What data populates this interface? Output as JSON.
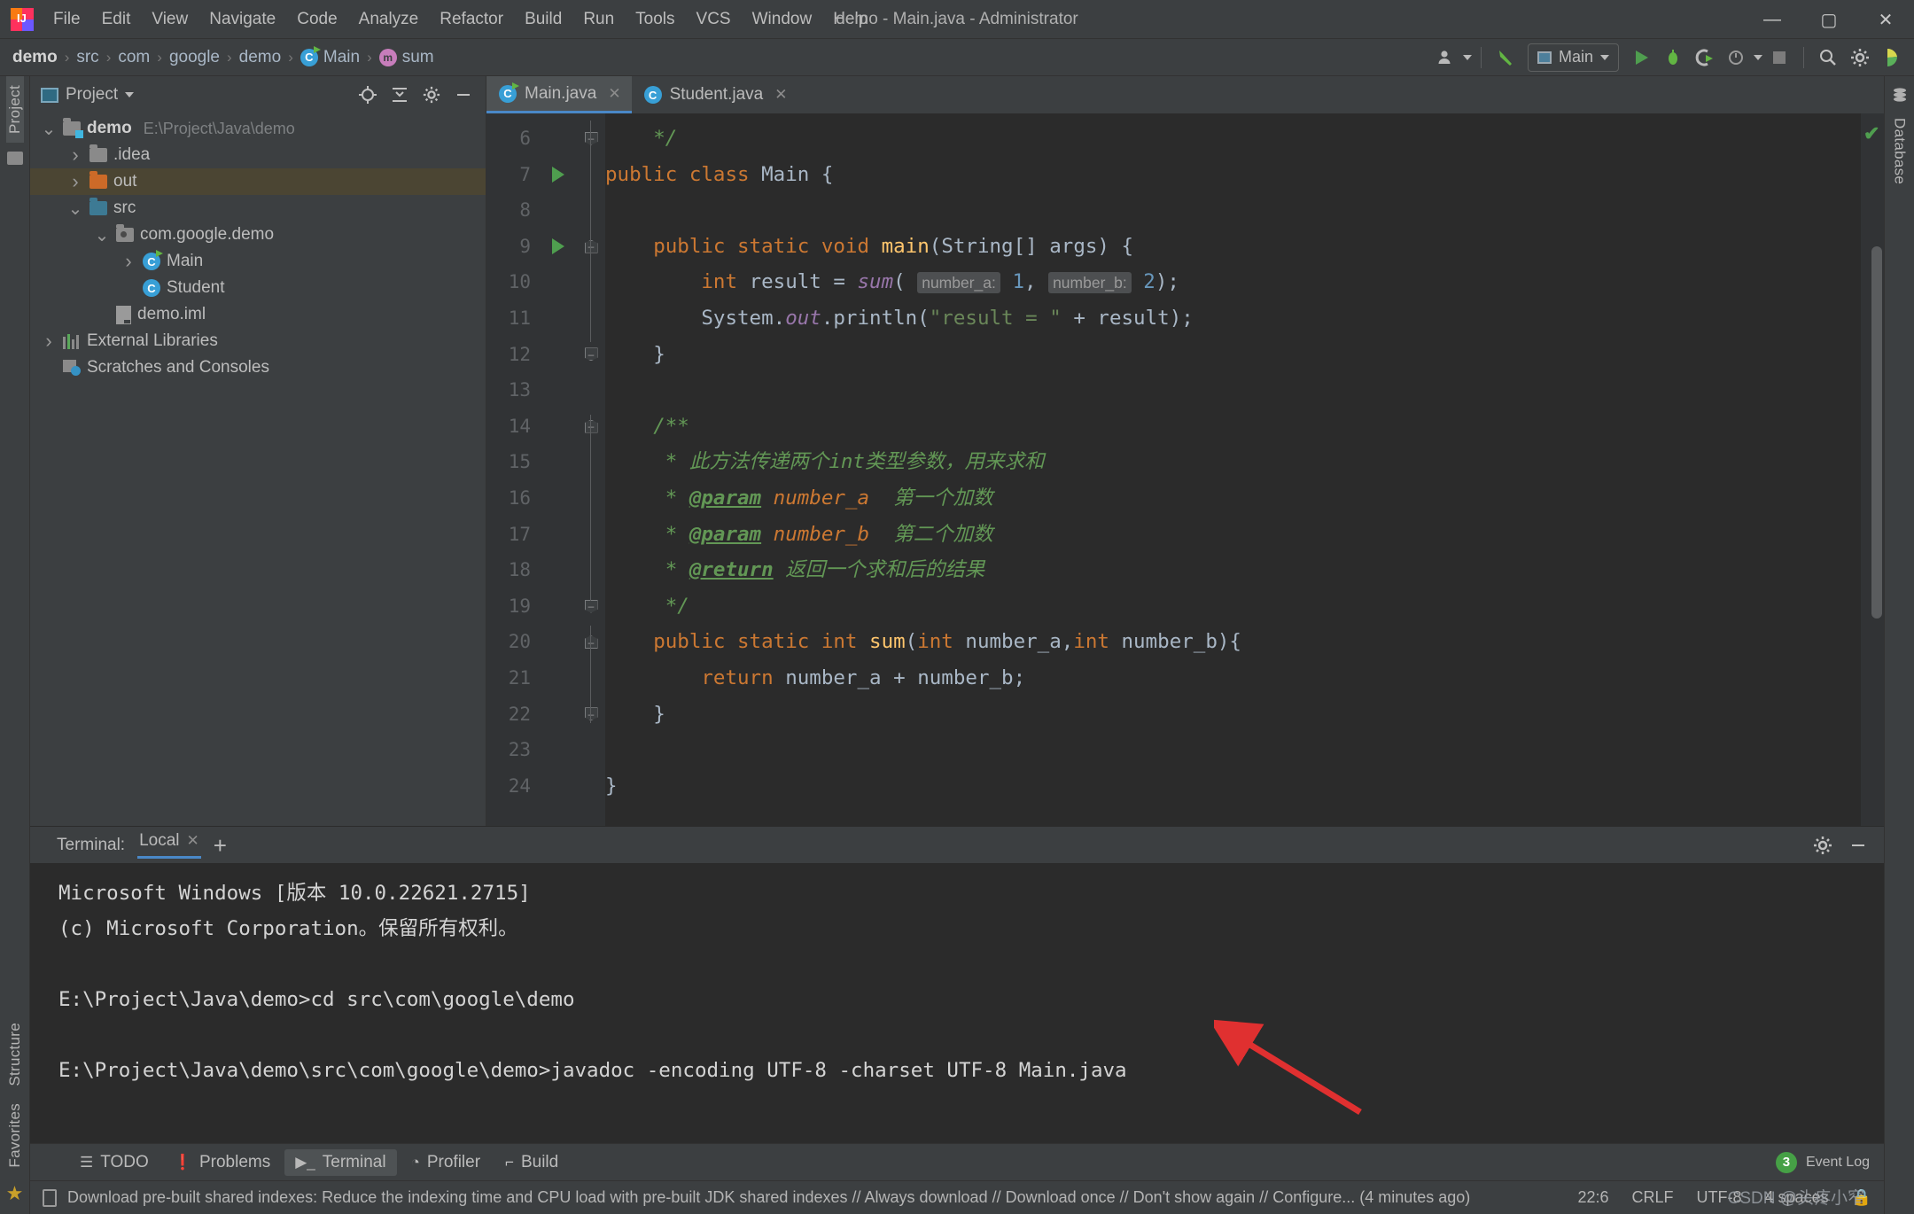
{
  "window": {
    "title": "demo - Main.java - Administrator",
    "minimize": "—",
    "maximize": "▢",
    "close": "✕"
  },
  "menubar": [
    {
      "label": "File"
    },
    {
      "label": "Edit"
    },
    {
      "label": "View"
    },
    {
      "label": "Navigate"
    },
    {
      "label": "Code"
    },
    {
      "label": "Analyze"
    },
    {
      "label": "Refactor"
    },
    {
      "label": "Build"
    },
    {
      "label": "Run"
    },
    {
      "label": "Tools"
    },
    {
      "label": "VCS"
    },
    {
      "label": "Window"
    },
    {
      "label": "Help"
    }
  ],
  "breadcrumb": {
    "items": [
      "demo",
      "src",
      "com",
      "google",
      "demo",
      "Main",
      "sum"
    ],
    "separator": "›"
  },
  "toolbar": {
    "run_config": "Main",
    "icons": [
      "user-avatar-icon",
      "hammer-build-icon",
      "run-icon",
      "debug-icon",
      "run-coverage-icon",
      "profiler-icon",
      "stop-icon",
      "search-everywhere-icon",
      "settings-gear-icon",
      "ide-helper-icon"
    ]
  },
  "left_strip": {
    "tabs": [
      "Project",
      "Structure",
      "Favorites"
    ]
  },
  "right_strip": {
    "tabs": [
      "Database"
    ]
  },
  "project_panel": {
    "title": "Project",
    "tree": [
      {
        "label": "demo",
        "hint": "E:\\Project\\Java\\demo",
        "indent": 0,
        "arrow": "v",
        "icon": "module-folder-icon",
        "bold": true,
        "selected": false
      },
      {
        "label": ".idea",
        "hint": "",
        "indent": 1,
        "arrow": ">",
        "icon": "folder-grey-icon",
        "bold": false,
        "selected": false
      },
      {
        "label": "out",
        "hint": "",
        "indent": 1,
        "arrow": ">",
        "icon": "folder-orange-icon",
        "bold": false,
        "selected": true
      },
      {
        "label": "src",
        "hint": "",
        "indent": 1,
        "arrow": "v",
        "icon": "folder-blue-icon",
        "bold": false,
        "selected": false
      },
      {
        "label": "com.google.demo",
        "hint": "",
        "indent": 2,
        "arrow": "v",
        "icon": "package-icon",
        "bold": false,
        "selected": false
      },
      {
        "label": "Main",
        "hint": "",
        "indent": 3,
        "arrow": ">",
        "icon": "java-class-runnable-icon",
        "bold": false,
        "selected": false
      },
      {
        "label": "Student",
        "hint": "",
        "indent": 3,
        "arrow": "",
        "icon": "java-class-icon",
        "bold": false,
        "selected": false
      },
      {
        "label": "demo.iml",
        "hint": "",
        "indent": 2,
        "arrow": "",
        "icon": "iml-file-icon",
        "bold": false,
        "selected": false
      },
      {
        "label": "External Libraries",
        "hint": "",
        "indent": 0,
        "arrow": ">",
        "icon": "libraries-icon",
        "bold": false,
        "selected": false
      },
      {
        "label": "Scratches and Consoles",
        "hint": "",
        "indent": 0,
        "arrow": "",
        "icon": "scratches-icon",
        "bold": false,
        "selected": false
      }
    ]
  },
  "editor": {
    "tabs": [
      {
        "label": "Main.java",
        "active": true,
        "close": "✕"
      },
      {
        "label": "Student.java",
        "active": false,
        "close": "✕"
      }
    ],
    "first_line": 6,
    "lines": [
      {
        "n": 6,
        "run": false,
        "fold": "bot",
        "html": "    <span class=\"cmt\">*/</span>"
      },
      {
        "n": 7,
        "run": true,
        "fold": "",
        "html": "<span class=\"kw\">public class </span><span class=\"cls\">Main </span><span class=\"pun\">{</span>"
      },
      {
        "n": 8,
        "run": false,
        "fold": "",
        "html": ""
      },
      {
        "n": 9,
        "run": true,
        "fold": "top",
        "html": "    <span class=\"kw\">public static void </span><span class=\"meth\">main</span><span class=\"pun\">(</span><span class=\"cls\">String</span><span class=\"pun\">[] args) {</span>"
      },
      {
        "n": 10,
        "run": false,
        "fold": "",
        "html": "        <span class=\"kw\">int </span><span class=\"cls\">result </span><span class=\"pun\">= </span><span class=\"field\">sum</span><span class=\"pun\">(</span> <span class=\"inlay\">number_a:</span> <span class=\"num\">1</span><span class=\"pun\">,</span> <span class=\"inlay\">number_b:</span> <span class=\"num\">2</span><span class=\"pun\">);</span>"
      },
      {
        "n": 11,
        "run": false,
        "fold": "",
        "html": "        <span class=\"cls\">System</span><span class=\"pun\">.</span><span class=\"field\">out</span><span class=\"pun\">.</span><span class=\"cls\">println</span><span class=\"pun\">(</span><span class=\"str\">\"result = \" </span><span class=\"pun\">+ result);</span>"
      },
      {
        "n": 12,
        "run": false,
        "fold": "bot",
        "html": "    <span class=\"pun\">}</span>"
      },
      {
        "n": 13,
        "run": false,
        "fold": "",
        "html": ""
      },
      {
        "n": 14,
        "run": false,
        "fold": "top",
        "html": "    <span class=\"cmt\">/**</span>"
      },
      {
        "n": 15,
        "run": false,
        "fold": "",
        "html": "     <span class=\"cmt\">* 此方法传递两个int类型参数，用来求和</span>"
      },
      {
        "n": 16,
        "run": false,
        "fold": "",
        "html": "     <span class=\"cmt\">* </span><span class=\"tag\">@param</span><span class=\"cmt\"> </span><span class=\"pname\">number_a</span><span class=\"cmt\">  第一个加数</span>"
      },
      {
        "n": 17,
        "run": false,
        "fold": "",
        "html": "     <span class=\"cmt\">* </span><span class=\"tag\">@param</span><span class=\"cmt\"> </span><span class=\"pname\">number_b</span><span class=\"cmt\">  第二个加数</span>"
      },
      {
        "n": 18,
        "run": false,
        "fold": "",
        "html": "     <span class=\"cmt\">* </span><span class=\"tag\">@return</span><span class=\"cmt\"> 返回一个求和后的结果</span>"
      },
      {
        "n": 19,
        "run": false,
        "fold": "bot",
        "html": "     <span class=\"cmt\">*/</span>"
      },
      {
        "n": 20,
        "run": false,
        "fold": "top",
        "html": "    <span class=\"kw\">public static int </span><span class=\"meth\">sum</span><span class=\"pun\">(</span><span class=\"kw\">int </span><span class=\"cls\">number_a</span><span class=\"pun\">,</span><span class=\"kw\">int </span><span class=\"cls\">number_b</span><span class=\"pun\">){</span>"
      },
      {
        "n": 21,
        "run": false,
        "fold": "",
        "html": "        <span class=\"kw\">return </span><span class=\"cls\">number_a </span><span class=\"pun\">+ </span><span class=\"cls\">number_b</span><span class=\"pun\">;</span>"
      },
      {
        "n": 22,
        "run": false,
        "fold": "bot",
        "html": "    <span class=\"pun\">}</span>"
      },
      {
        "n": 23,
        "run": false,
        "fold": "",
        "html": ""
      },
      {
        "n": 24,
        "run": false,
        "fold": "",
        "html": "<span class=\"pun\">}</span>"
      }
    ],
    "inspection_status": "✔"
  },
  "terminal": {
    "label": "Terminal:",
    "tab": "Local",
    "tab_close": "✕",
    "new_tab": "+",
    "settings_icon": "gear-icon",
    "hide_icon": "minimize-icon",
    "lines": [
      "Microsoft Windows [版本 10.0.22621.2715]",
      "(c) Microsoft Corporation。保留所有权利。",
      "",
      "E:\\Project\\Java\\demo>cd src\\com\\google\\demo",
      "",
      "E:\\Project\\Java\\demo\\src\\com\\google\\demo>javadoc -encoding UTF-8 -charset UTF-8 Main.java"
    ]
  },
  "bottom_tools": [
    {
      "label": "TODO",
      "icon": "todo-list-icon",
      "selected": false
    },
    {
      "label": "Problems",
      "icon": "problems-icon",
      "selected": false
    },
    {
      "label": "Terminal",
      "icon": "terminal-icon",
      "selected": true
    },
    {
      "label": "Profiler",
      "icon": "profiler-icon",
      "selected": false
    },
    {
      "label": "Build",
      "icon": "build-hammer-icon",
      "selected": false
    }
  ],
  "event_log": {
    "count": "3",
    "label": "Event Log"
  },
  "statusbar": {
    "message": "Download pre-built shared indexes: Reduce the indexing time and CPU load with pre-built JDK shared indexes // Always download // Download once // Don't show again // Configure... (4 minutes ago)",
    "caret": "22:6",
    "line_sep": "CRLF",
    "encoding": "UTF-8",
    "indent": "4 spaces",
    "lock_icon": "lock-icon"
  },
  "watermark": "CSDN @头疼小窄",
  "colors": {
    "accent_blue": "#4a88c7",
    "run_green": "#4f9e4f",
    "selection": "#4b4533",
    "editor_bg": "#2b2b2b",
    "panel_bg": "#3c3f41",
    "annotation_arrow": "#e03030"
  }
}
